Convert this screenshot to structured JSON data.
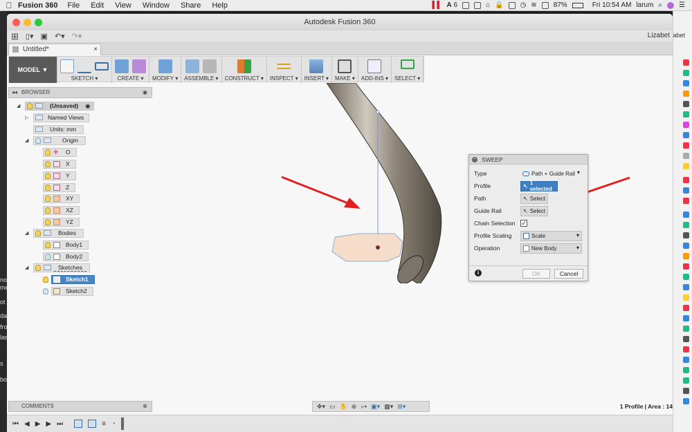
{
  "menubar": {
    "app_name": "Fusion 360",
    "menus": [
      "File",
      "Edit",
      "View",
      "Window",
      "Share",
      "Help"
    ],
    "badge_count": "6",
    "battery": "87%",
    "clock": "Fri 10:54 AM",
    "user": "larum"
  },
  "left_strip": [
    "no",
    "me",
    "ot",
    "da",
    "fro",
    "las",
    "s",
    "bo"
  ],
  "window": {
    "title": "Autodesk Fusion 360",
    "user_short": "Lizabet",
    "doc_tab": "Untitled*"
  },
  "toolbar": {
    "mode": "MODEL ▼",
    "groups": [
      {
        "label": "SKETCH ▾",
        "icons": [
          "sketch-icon",
          "spline-icon",
          "rectangle-icon"
        ]
      },
      {
        "label": "CREATE ▾",
        "icons": [
          "extrude-icon",
          "form-icon"
        ]
      },
      {
        "label": "MODIFY ▾",
        "icons": [
          "presspull-icon"
        ]
      },
      {
        "label": "ASSEMBLE ▾",
        "icons": [
          "component-icon",
          "joint-icon"
        ]
      },
      {
        "label": "CONSTRUCT ▾",
        "icons": [
          "plane-icon"
        ]
      },
      {
        "label": "INSPECT ▾",
        "icons": [
          "measure-icon"
        ]
      },
      {
        "label": "INSERT ▾",
        "icons": [
          "image-icon"
        ]
      },
      {
        "label": "MAKE ▾",
        "icons": [
          "print-icon"
        ]
      },
      {
        "label": "ADD-INS ▾",
        "icons": [
          "scripts-icon"
        ]
      },
      {
        "label": "SELECT ▾",
        "icons": [
          "select-icon"
        ]
      }
    ]
  },
  "browser": {
    "title": "BROWSER",
    "root": "(Unsaved)",
    "named_views": "Named Views",
    "units": "Units: mm",
    "origin": "Origin",
    "origin_items": [
      "O",
      "X",
      "Y",
      "Z",
      "XY",
      "XZ",
      "YZ"
    ],
    "bodies": "Bodies",
    "body_items": [
      "Body1",
      "Body2"
    ],
    "sketches": "Sketches",
    "sketch_items": [
      "Sketch1",
      "Sketch2"
    ]
  },
  "sweep": {
    "title": "SWEEP",
    "rows": [
      {
        "label": "Type",
        "value": "Path + Guide Rail"
      },
      {
        "label": "Profile",
        "value": "1 selected"
      },
      {
        "label": "Path",
        "value": "Select"
      },
      {
        "label": "Guide Rail",
        "value": "Select"
      },
      {
        "label": "Chain Selection",
        "value": "✓"
      },
      {
        "label": "Profile Scaling",
        "value": "Scale"
      },
      {
        "label": "Operation",
        "value": "New Body"
      }
    ],
    "ok": "OK",
    "cancel": "Cancel"
  },
  "comments": {
    "title": "COMMENTS"
  },
  "status": "1 Profile | Area : 14",
  "colors": {
    "accent": "#3f7fc4",
    "arrow": "#e02020",
    "profile_fill": "#f6dcc8"
  }
}
